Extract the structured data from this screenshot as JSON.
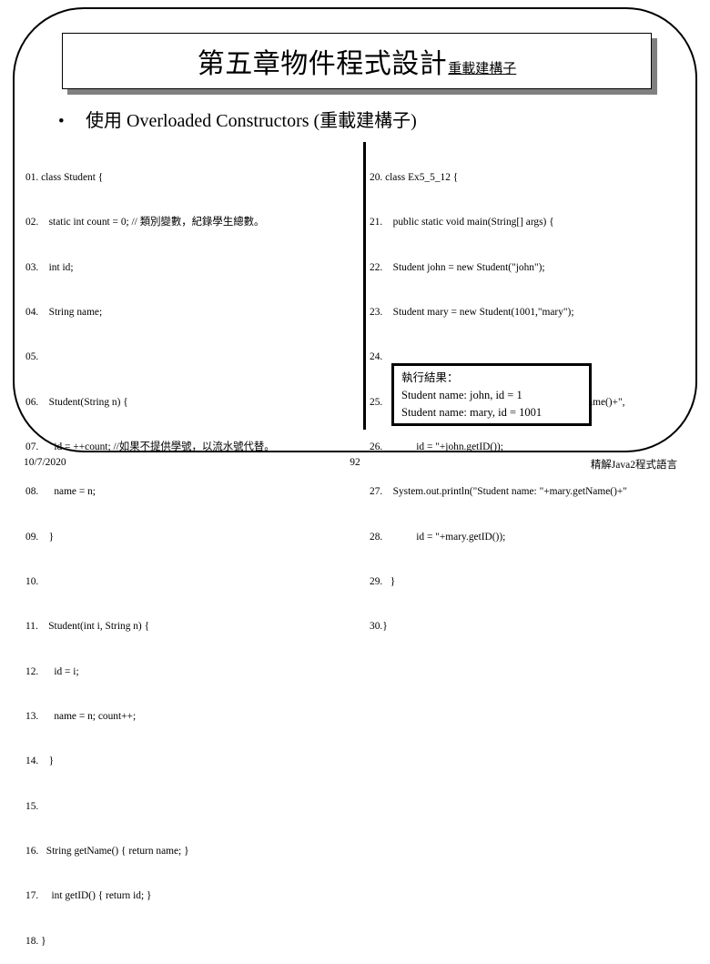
{
  "slide": {
    "title_main": "第五章物件程式設計",
    "title_sub": "重載建構子",
    "bullet_mark": "•",
    "bullet_text": "使用 Overloaded Constructors (重載建構子)"
  },
  "code_left": {
    "lines": [
      "01. class Student {",
      "02.    static int count = 0; // 類別變數，紀錄學生總數。",
      "03.    int id;",
      "04.    String name;",
      "05.",
      "06.    Student(String n) {",
      "07.      id = ++count; //如果不提供學號，以流水號代替。",
      "08.      name = n;",
      "09.    }",
      "10.",
      "11.    Student(int i, String n) {",
      "12.      id = i;",
      "13.      name = n; count++;",
      "14.    }",
      "15.",
      "16.   String getName() { return name; }",
      "17.     int getID() { return id; }",
      "18. }"
    ]
  },
  "code_right": {
    "lines": [
      "20. class Ex5_5_12 {",
      "21.    public static void main(String[] args) {",
      "22.    Student john = new Student(\"john\");",
      "23.    Student mary = new Student(1001,\"mary\");",
      "24.",
      "25.    System.out.println(\"Student name:\"+john.getName()+\",",
      "26.             id = \"+john.getID());",
      "27.    System.out.println(\"Student name: \"+mary.getName()+\"",
      "28.             id = \"+mary.getID());",
      "29.   }",
      "30.}"
    ]
  },
  "output_box": {
    "lines": [
      "執行結果：",
      "Student name: john, id = 1",
      "Student name: mary, id = 1001"
    ]
  },
  "footer": {
    "date": "10/7/2020",
    "page_number": "92",
    "source": "精解Java2程式語言"
  },
  "colors": {
    "text": "#000000",
    "background": "#ffffff",
    "shadow": "#808080"
  }
}
